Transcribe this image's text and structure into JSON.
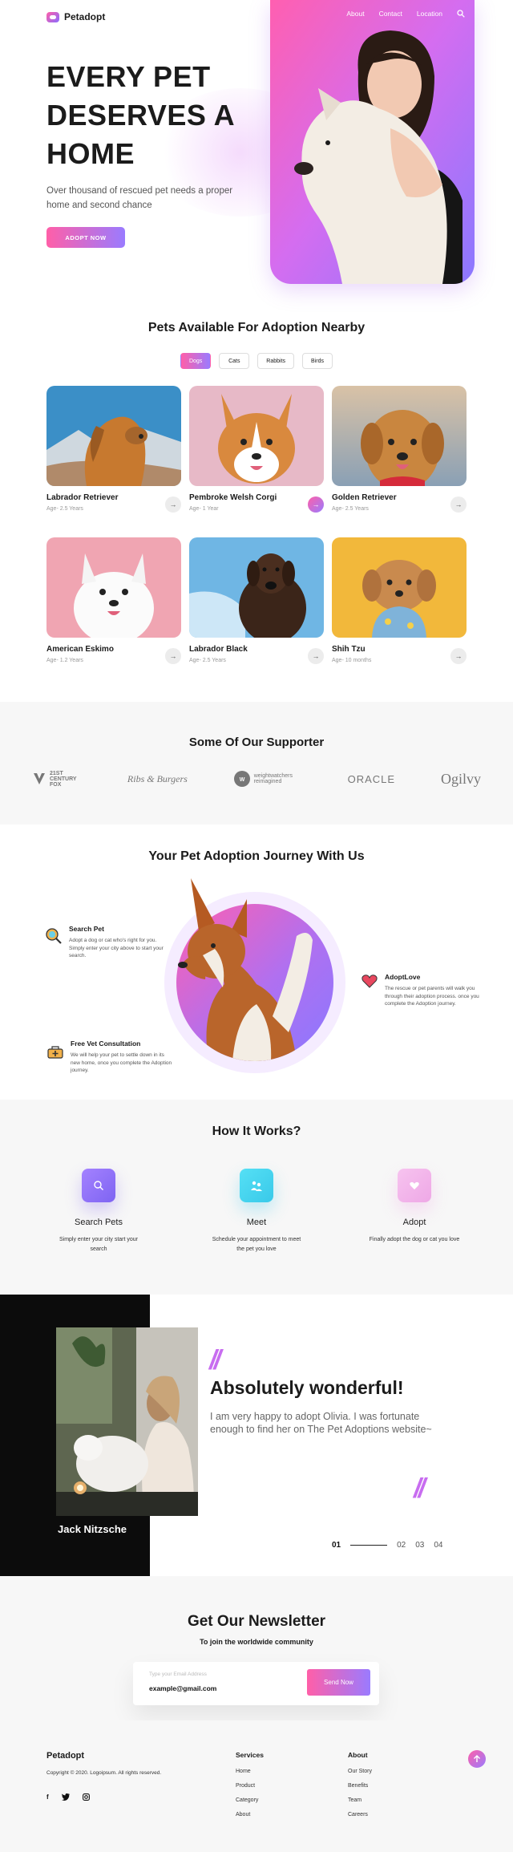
{
  "brand": {
    "name": "Petadopt"
  },
  "nav": {
    "items": [
      "About",
      "Contact",
      "Location"
    ]
  },
  "hero": {
    "title_lines": [
      "EVERY PET",
      "DESERVES A",
      "HOME"
    ],
    "subtitle": "Over thousand of rescued pet needs a proper home and second chance",
    "cta": "ADOPT NOW"
  },
  "pets_section": {
    "title": "Pets Available For Adoption Nearby",
    "tabs": [
      "Dogs",
      "Cats",
      "Rabbits",
      "Birds"
    ],
    "active_tab": "Dogs",
    "pets": [
      {
        "name": "Labrador Retriever",
        "age": "Age- 2.5 Years"
      },
      {
        "name": "Pembroke Welsh Corgi",
        "age": "Age- 1 Year"
      },
      {
        "name": "Golden Retriever",
        "age": "Age- 2.5 Years"
      },
      {
        "name": "American Eskimo",
        "age": "Age- 1.2 Years"
      },
      {
        "name": "Labrador Black",
        "age": "Age- 2.5 Years"
      },
      {
        "name": "Shih Tzu",
        "age": "Age- 10 months"
      }
    ]
  },
  "supporters": {
    "title": "Some Of Our Supporter",
    "logos": [
      "21ST CENTURY FOX",
      "Ribs & Burgers",
      "weightwatchers reimagined",
      "ORACLE",
      "Ogilvy"
    ]
  },
  "journey": {
    "title": "Your Pet Adoption Journey With Us",
    "steps": [
      {
        "title": "Search Pet",
        "text": "Adopt a dog or cat who's right for you. Simply enter your city above to start your search."
      },
      {
        "title": "AdoptLove",
        "text": "The rescue or pet parents will walk you through their adoption process. once you complete the Adoption journey."
      },
      {
        "title": "Free Vet Consultation",
        "text": "We will help your pet to settle down in its new home, once you complete the Adoption journey."
      }
    ]
  },
  "how": {
    "title": "How It Works?",
    "steps": [
      {
        "title": "Search Pets",
        "text": "Simply enter your city start your search"
      },
      {
        "title": "Meet",
        "text": "Schedule your appointment to meet the pet you love"
      },
      {
        "title": "Adopt",
        "text": "Finally adopt the dog or cat you love"
      }
    ]
  },
  "testimonial": {
    "name": "Jack Nitzsche",
    "headline": "Absolutely wonderful!",
    "quote": "I am very happy to adopt Olivia. I was fortunate enough to find her on The Pet  Adoptions website~",
    "pages": [
      "01",
      "02",
      "03",
      "04"
    ]
  },
  "newsletter": {
    "title": "Get Our Newsletter",
    "subtitle": "To join the worldwide community",
    "placeholder": "Type your Email Address",
    "value": "example@gmail.com",
    "button": "Send Now"
  },
  "footer": {
    "brand": "Petadopt",
    "copyright": "Copyright © 2020. Logoipsum. All rights reserved.",
    "services_title": "Services",
    "services": [
      "Home",
      "Product",
      "Category",
      "About"
    ],
    "about_title": "About",
    "about": [
      "Our Story",
      "Benefits",
      "Team",
      "Careers"
    ],
    "social": [
      "f",
      "t",
      "o"
    ]
  },
  "colors": {
    "accent_pink": "#ff5fa8",
    "accent_purple": "#9a7bff",
    "cyan": "#4dd9f0",
    "dark": "#0c0c0c"
  }
}
